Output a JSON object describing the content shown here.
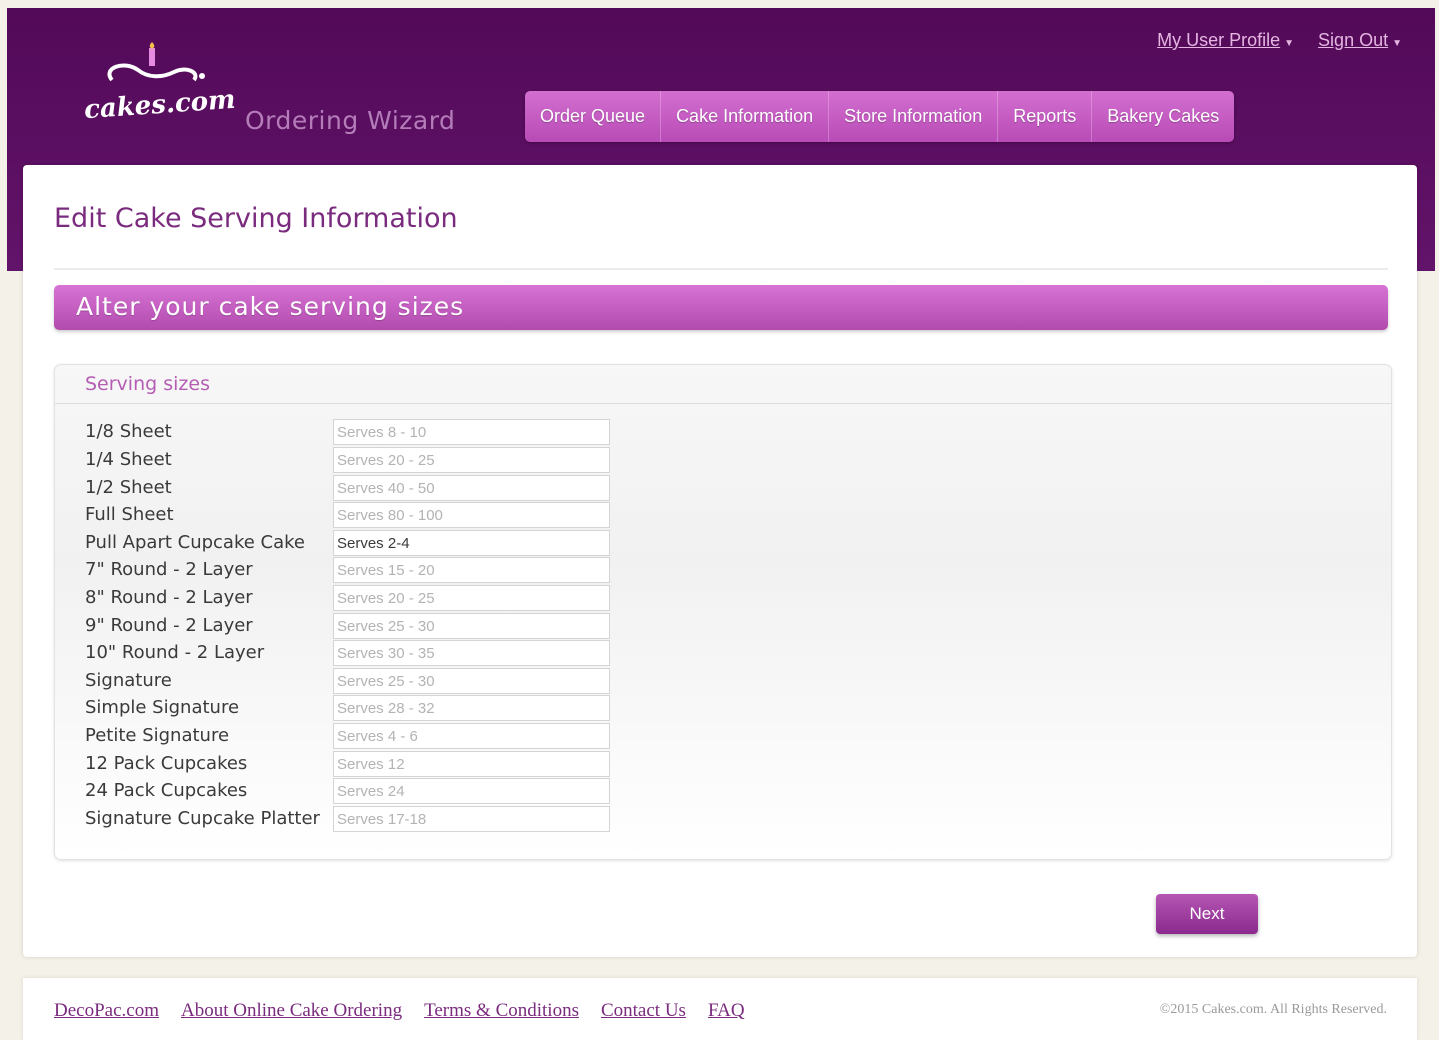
{
  "brand": {
    "logo_text": "cakes.com",
    "app_name": "Ordering Wizard"
  },
  "user_menu": {
    "profile_label": "My User Profile",
    "sign_out_label": "Sign Out"
  },
  "nav": {
    "items": [
      {
        "label": "Order Queue"
      },
      {
        "label": "Cake Information"
      },
      {
        "label": "Store Information"
      },
      {
        "label": "Reports"
      },
      {
        "label": "Bakery Cakes"
      }
    ]
  },
  "page": {
    "title": "Edit Cake Serving Information",
    "banner": "Alter your cake serving sizes"
  },
  "serving_sizes": {
    "title": "Serving sizes",
    "rows": [
      {
        "label": "1/8 Sheet",
        "value": "",
        "placeholder": "Serves 8 - 10"
      },
      {
        "label": "1/4 Sheet",
        "value": "",
        "placeholder": "Serves 20 - 25"
      },
      {
        "label": "1/2 Sheet",
        "value": "",
        "placeholder": "Serves 40 - 50"
      },
      {
        "label": "Full Sheet",
        "value": "",
        "placeholder": "Serves 80 - 100"
      },
      {
        "label": "Pull Apart Cupcake Cake",
        "value": "Serves 2-4",
        "placeholder": ""
      },
      {
        "label": "7\" Round - 2 Layer",
        "value": "",
        "placeholder": "Serves 15 - 20"
      },
      {
        "label": "8\" Round - 2 Layer",
        "value": "",
        "placeholder": "Serves 20 - 25"
      },
      {
        "label": "9\" Round - 2 Layer",
        "value": "",
        "placeholder": "Serves 25 - 30"
      },
      {
        "label": "10\" Round - 2 Layer",
        "value": "",
        "placeholder": "Serves 30 - 35"
      },
      {
        "label": "Signature",
        "value": "",
        "placeholder": "Serves 25 - 30"
      },
      {
        "label": "Simple Signature",
        "value": "",
        "placeholder": "Serves 28 - 32"
      },
      {
        "label": "Petite Signature",
        "value": "",
        "placeholder": "Serves 4 - 6"
      },
      {
        "label": "12 Pack Cupcakes",
        "value": "",
        "placeholder": "Serves 12"
      },
      {
        "label": "24 Pack Cupcakes",
        "value": "",
        "placeholder": "Serves 24"
      },
      {
        "label": "Signature Cupcake Platter",
        "value": "",
        "placeholder": "Serves 17-18"
      }
    ]
  },
  "actions": {
    "next_label": "Next"
  },
  "footer": {
    "links": [
      {
        "label": "DecoPac.com"
      },
      {
        "label": "About Online Cake Ordering"
      },
      {
        "label": "Terms & Conditions"
      },
      {
        "label": "Contact Us"
      },
      {
        "label": "FAQ"
      }
    ],
    "copyright": "©2015 Cakes.com. All Rights Reserved."
  },
  "colors": {
    "header_bg": "#5a0d60",
    "accent": "#c45fc2",
    "title": "#7a2b7e"
  }
}
